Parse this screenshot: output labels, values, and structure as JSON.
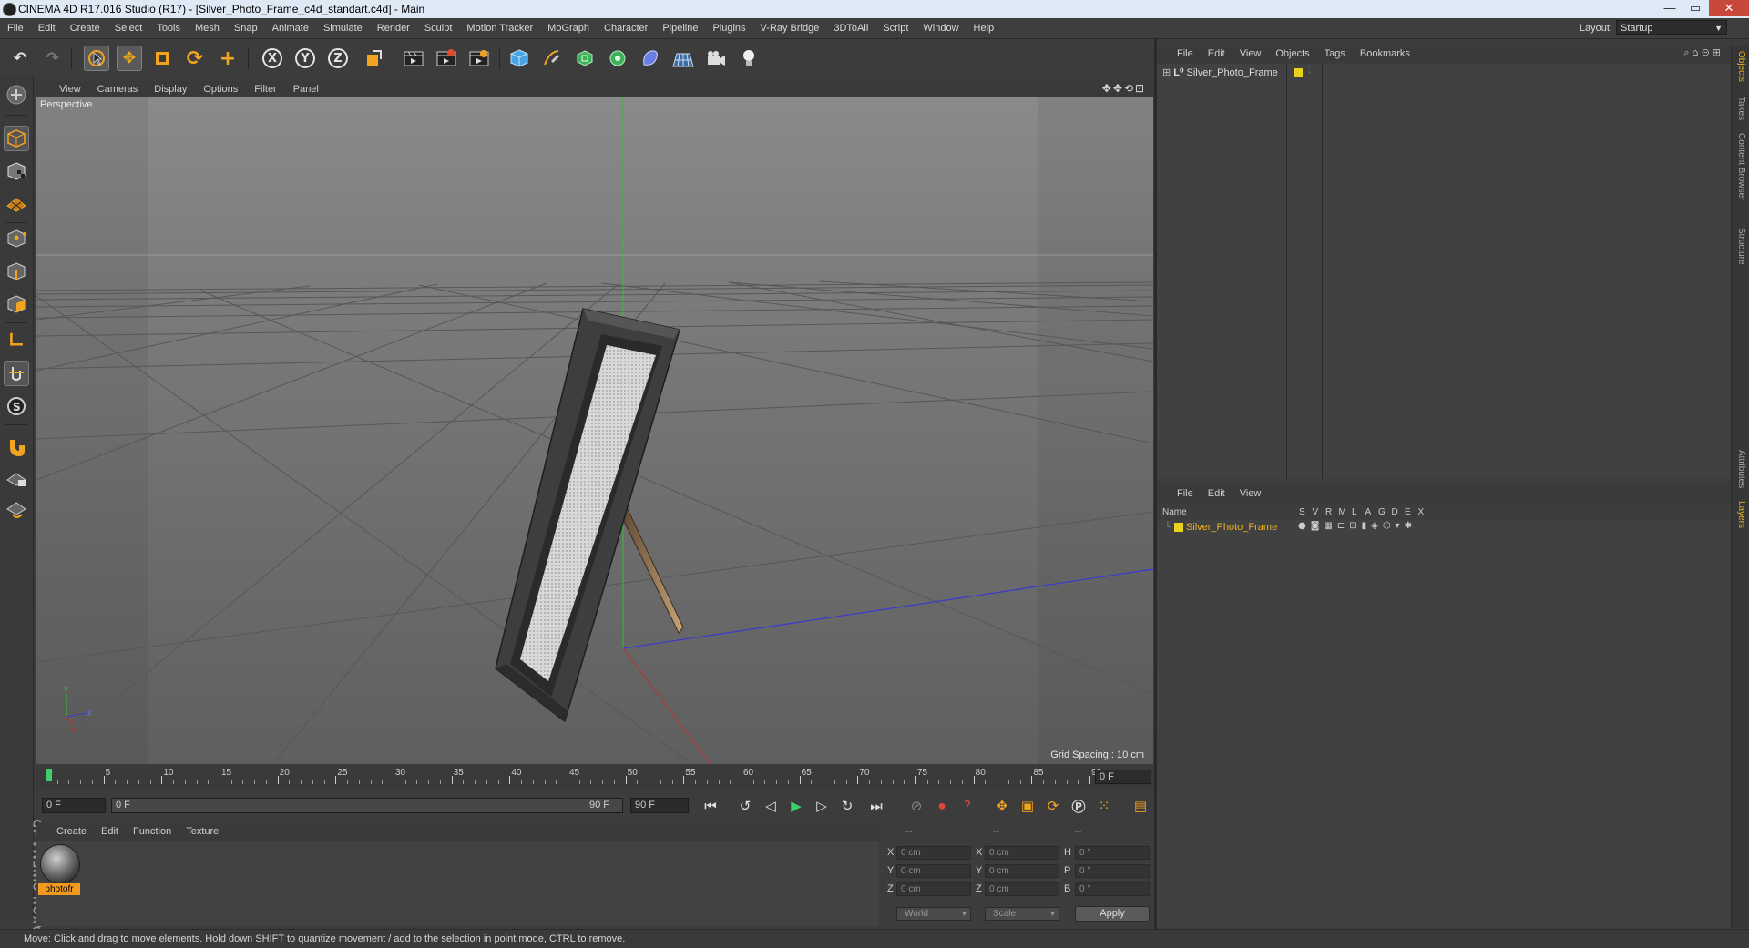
{
  "window": {
    "title": "CINEMA 4D R17.016 Studio (R17) - [Silver_Photo_Frame_c4d_standart.c4d] - Main",
    "minimize": "—",
    "maximize": "▭",
    "close": "✕"
  },
  "menubar": {
    "items": [
      "File",
      "Edit",
      "Create",
      "Select",
      "Tools",
      "Mesh",
      "Snap",
      "Animate",
      "Simulate",
      "Render",
      "Sculpt",
      "Motion Tracker",
      "MoGraph",
      "Character",
      "Pipeline",
      "Plugins",
      "V-Ray Bridge",
      "3DToAll",
      "Script",
      "Window",
      "Help"
    ],
    "layout_label": "Layout:",
    "layout_value": "Startup"
  },
  "toolbar": {
    "icons": [
      "undo-icon",
      "redo-icon",
      "live-selection-icon",
      "move-icon",
      "scale-icon",
      "rotate-icon",
      "last-tool-icon",
      "x-axis-icon",
      "y-axis-icon",
      "z-axis-icon",
      "coordinate-system-icon",
      "render-view-icon",
      "render-picture-viewer-icon",
      "edit-render-settings-icon",
      "cube-icon",
      "pen-spline-icon",
      "subdivision-icon",
      "cloner-icon",
      "deformer-icon",
      "floor-icon",
      "camera-icon",
      "light-icon"
    ],
    "axis_labels": [
      "X",
      "Y",
      "Z"
    ]
  },
  "viewport": {
    "menu": [
      "View",
      "Cameras",
      "Display",
      "Options",
      "Filter",
      "Panel"
    ],
    "label": "Perspective",
    "grid_spacing": "Grid Spacing : 10 cm",
    "nav_icons": "✥✥⟲⊡"
  },
  "timeline": {
    "ticks": [
      "0",
      "5",
      "10",
      "15",
      "20",
      "25",
      "30",
      "35",
      "40",
      "45",
      "50",
      "55",
      "60",
      "65",
      "70",
      "75",
      "80",
      "85",
      "90"
    ],
    "current_frame": "0 F",
    "max_tick": 90
  },
  "transport": {
    "start_field": "0 F",
    "range_start": "0 F",
    "range_end": "90 F",
    "end_field": "90 F"
  },
  "material_manager": {
    "menu": [
      "Create",
      "Edit",
      "Function",
      "Texture"
    ],
    "materials": [
      {
        "name": "photofr"
      }
    ]
  },
  "coordinates": {
    "header": [
      "--",
      "--",
      "--"
    ],
    "rows": [
      {
        "a": "X",
        "av": "0 cm",
        "b": "X",
        "bv": "0 cm",
        "c": "H",
        "cv": "0 °"
      },
      {
        "a": "Y",
        "av": "0 cm",
        "b": "Y",
        "bv": "0 cm",
        "c": "P",
        "cv": "0 °"
      },
      {
        "a": "Z",
        "av": "0 cm",
        "b": "Z",
        "bv": "0 cm",
        "c": "B",
        "cv": "0 °"
      }
    ],
    "mode": "World",
    "size_mode": "Scale",
    "apply": "Apply"
  },
  "object_manager": {
    "menu": [
      "File",
      "Edit",
      "View",
      "Objects",
      "Tags",
      "Bookmarks"
    ],
    "objects": [
      {
        "name": "Silver_Photo_Frame",
        "color": "#e8d21c"
      }
    ]
  },
  "layer_manager": {
    "menu": [
      "File",
      "Edit",
      "View"
    ],
    "columns": [
      "Name",
      "S",
      "V",
      "R",
      "M",
      "L",
      "A",
      "G",
      "D",
      "E",
      "X"
    ],
    "layers": [
      {
        "name": "Silver_Photo_Frame",
        "color": "#e8d21c"
      }
    ]
  },
  "right_tabs": [
    "Objects",
    "Takes",
    "Content Browser",
    "Structure",
    "Attributes",
    "Layers"
  ],
  "status": "Move: Click and drag to move elements. Hold down SHIFT to quantize movement / add to the selection in point mode, CTRL to remove.",
  "branding": "MAXON CINEMA 4D",
  "colors": {
    "accent": "#f29a1f",
    "selected_layer": "#f0b21a",
    "timeline_cursor": "#3fd06a"
  }
}
